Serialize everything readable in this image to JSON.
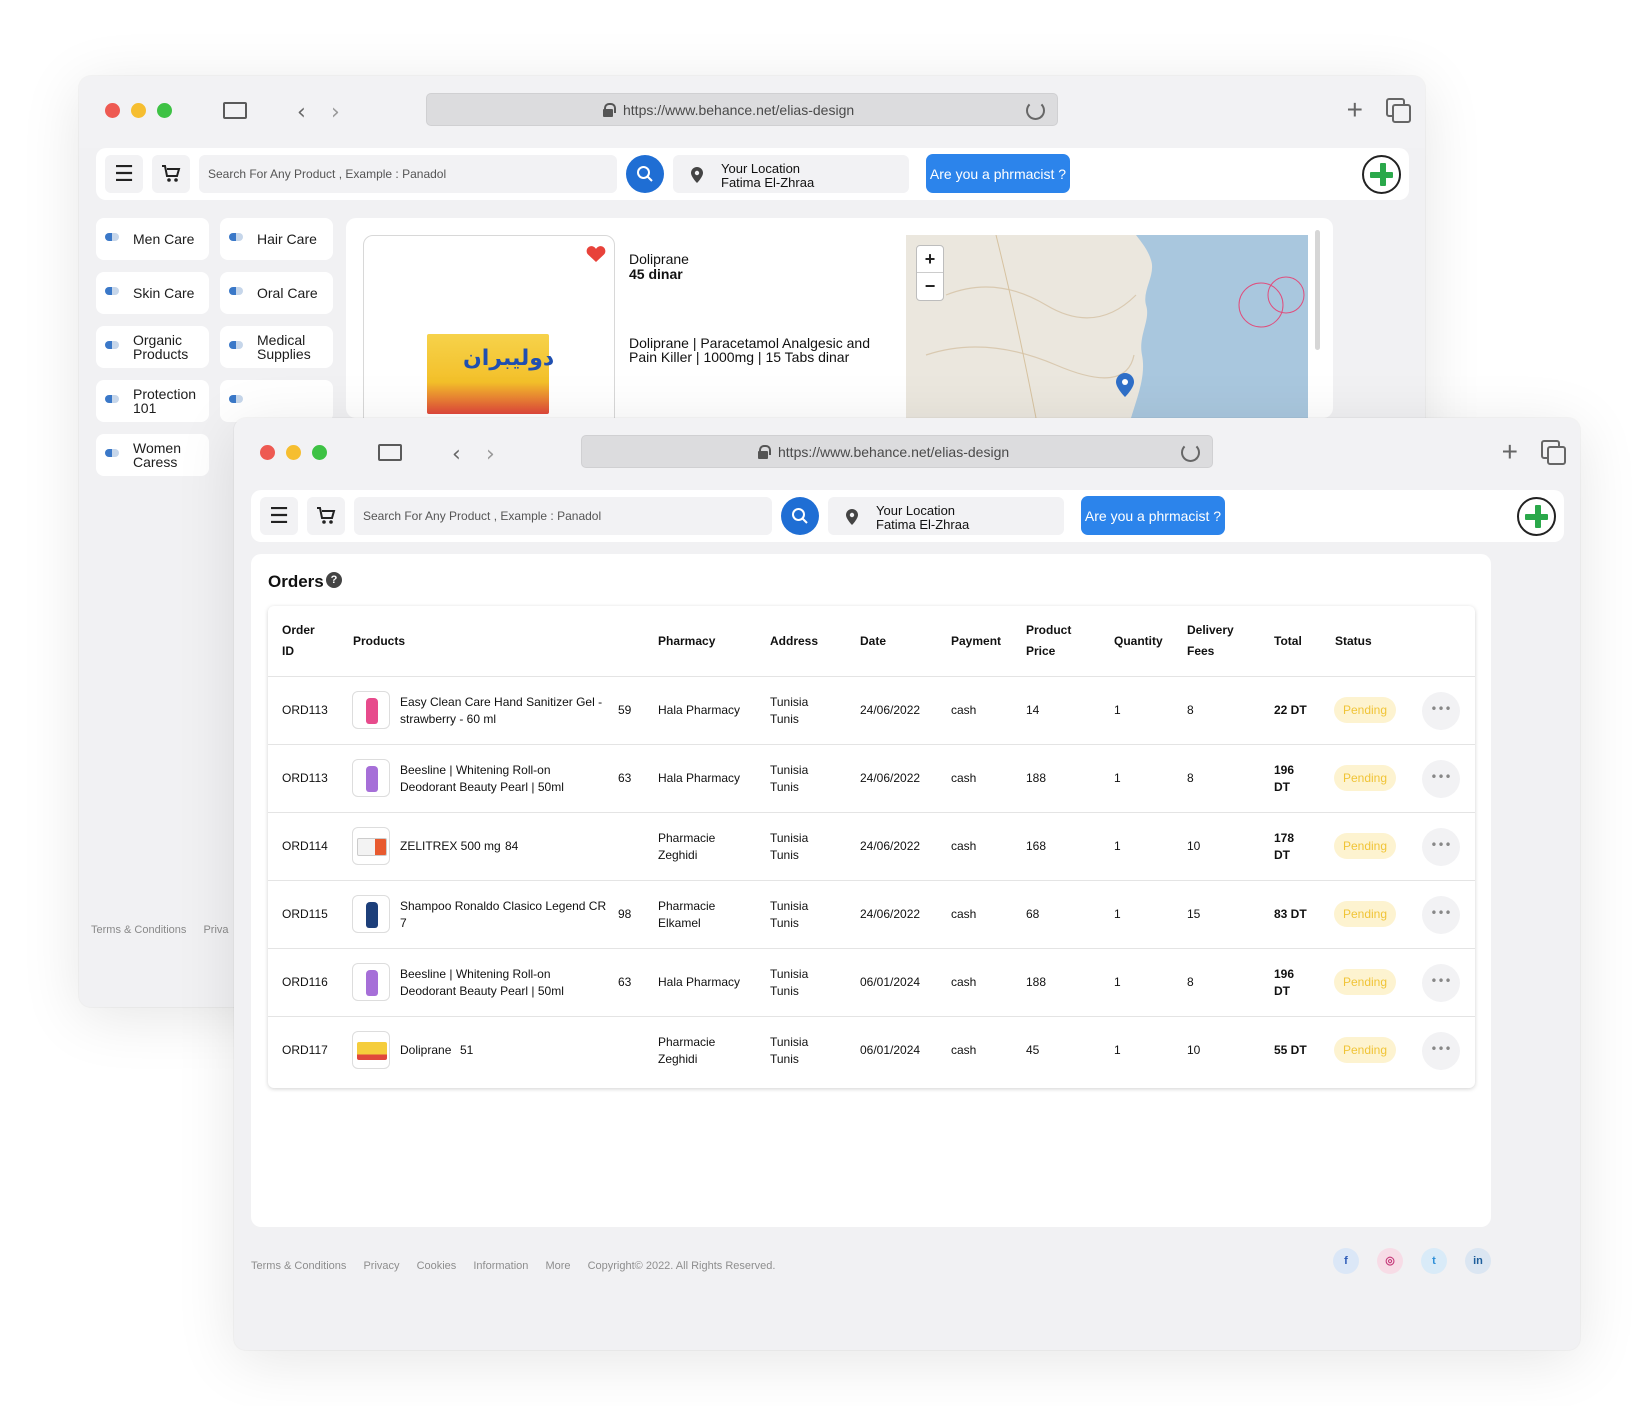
{
  "browser": {
    "url": "https://www.behance.net/elias-design"
  },
  "header": {
    "search_placeholder": "Search For Any Product , Example : Panadol",
    "location_label": "Your Location",
    "location_value": "Fatima El-Zhraa",
    "pharmacist_button": "Are you a phrmacist ?"
  },
  "categories": [
    {
      "label": "Men Care"
    },
    {
      "label": "Hair Care"
    },
    {
      "label": "Skin Care"
    },
    {
      "label": "Oral Care"
    },
    {
      "label": "Organic Products"
    },
    {
      "label": "Medical Supplies"
    },
    {
      "label": "Protection 101"
    },
    {
      "label": "Women Caress"
    }
  ],
  "product": {
    "name": "Doliprane",
    "price": "45 dinar",
    "description": "Doliprane | Paracetamol Analgesic and Pain Killer | 1000mg | 15 Tabs dinar",
    "box_text": "دوليبران"
  },
  "map": {
    "zoom_in": "+",
    "zoom_out": "−"
  },
  "back_footer": {
    "terms": "Terms & Conditions",
    "privacy": "Priva"
  },
  "orders": {
    "title": "Orders",
    "help": "?",
    "columns": {
      "order_id": "Order ID",
      "products": "Products",
      "pharmacy": "Pharmacy",
      "address": "Address",
      "date": "Date",
      "payment": "Payment",
      "product_price": "Product Price",
      "quantity": "Quantity",
      "delivery_fees": "Delivery Fees",
      "total": "Total",
      "status": "Status"
    },
    "rows": [
      {
        "id": "ORD113",
        "product": "Easy Clean Care Hand Sanitizer Gel - strawberry - 60 ml",
        "code": "59",
        "pharmacy": "Hala Pharmacy",
        "address": "Tunisia Tunis",
        "date": "24/06/2022",
        "payment": "cash",
        "price": "14",
        "quantity": "1",
        "fees": "8",
        "total": "22 DT",
        "status": "Pending",
        "more": "•••"
      },
      {
        "id": "ORD113",
        "product": "Beesline | Whitening Roll-on Deodorant Beauty Pearl | 50ml",
        "code": "63",
        "pharmacy": "Hala Pharmacy",
        "address": "Tunisia Tunis",
        "date": "24/06/2022",
        "payment": "cash",
        "price": "188",
        "quantity": "1",
        "fees": "8",
        "total": "196 DT",
        "status": "Pending",
        "more": "•••"
      },
      {
        "id": "ORD114",
        "product": "ZELITREX 500 mg",
        "code": "84",
        "pharmacy": "Pharmacie Zeghidi",
        "address": "Tunisia Tunis",
        "date": "24/06/2022",
        "payment": "cash",
        "price": "168",
        "quantity": "1",
        "fees": "10",
        "total": "178 DT",
        "status": "Pending",
        "more": "•••"
      },
      {
        "id": "ORD115",
        "product": "Shampoo Ronaldo Clasico Legend CR 7",
        "code": "98",
        "pharmacy": "Pharmacie Elkamel",
        "address": "Tunisia Tunis",
        "date": "24/06/2022",
        "payment": "cash",
        "price": "68",
        "quantity": "1",
        "fees": "15",
        "total": "83 DT",
        "status": "Pending",
        "more": "•••"
      },
      {
        "id": "ORD116",
        "product": "Beesline | Whitening Roll-on Deodorant Beauty Pearl | 50ml",
        "code": "63",
        "pharmacy": "Hala Pharmacy",
        "address": "Tunisia Tunis",
        "date": "06/01/2024",
        "payment": "cash",
        "price": "188",
        "quantity": "1",
        "fees": "8",
        "total": "196 DT",
        "status": "Pending",
        "more": "•••"
      },
      {
        "id": "ORD117",
        "product": "Doliprane",
        "code": "51",
        "pharmacy": "Pharmacie Zeghidi",
        "address": "Tunisia Tunis",
        "date": "06/01/2024",
        "payment": "cash",
        "price": "45",
        "quantity": "1",
        "fees": "10",
        "total": "55 DT",
        "status": "Pending",
        "more": "•••"
      }
    ]
  },
  "footer": {
    "links": [
      "Terms & Conditions",
      "Privacy",
      "Cookies",
      "Information",
      "More"
    ],
    "copyright": "Copyright© 2022. All Rights Reserved.",
    "social": {
      "facebook": "f",
      "instagram": "◎",
      "twitter": "t",
      "linkedin": "in"
    }
  },
  "colors": {
    "accent_blue": "#2c84eb",
    "search_blue": "#1f6ed4",
    "logo_green": "#2aa84a",
    "pending_text": "#f0c437",
    "pending_bg": "#fdf3d0"
  },
  "icons": [
    "menu-icon",
    "cart-icon",
    "search-icon",
    "location-pin-icon",
    "plus-logo-icon",
    "lock-icon",
    "reload-icon",
    "heart-icon",
    "help-icon",
    "more-icon"
  ]
}
